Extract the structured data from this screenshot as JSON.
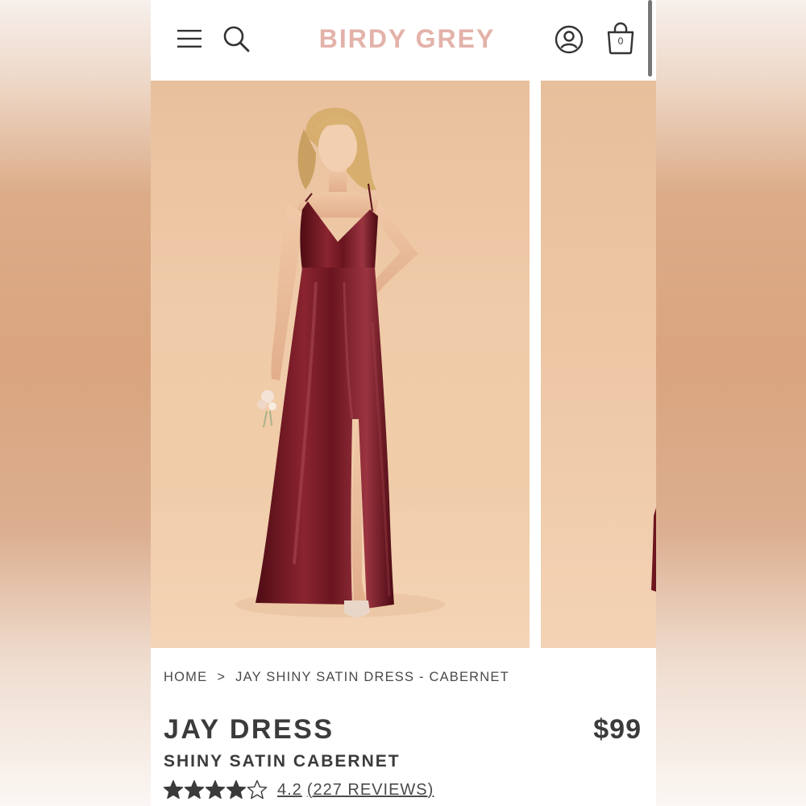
{
  "header": {
    "logo": "BIRDY GREY",
    "cart_count": "0"
  },
  "icons": {
    "menu": "hamburger-menu-icon",
    "search": "search-icon",
    "account": "account-icon",
    "cart": "shopping-bag-icon"
  },
  "breadcrumb": {
    "home": "HOME",
    "separator": ">",
    "current": "JAY SHINY SATIN DRESS - CABERNET"
  },
  "product": {
    "title": "JAY DRESS",
    "subtitle": "SHINY SATIN CABERNET",
    "price": "$99",
    "rating_value": "4.2",
    "rating_max": 5,
    "reviews_label": "(227 REVIEWS)"
  },
  "colors": {
    "logo": "#e3b2a9",
    "dress": "#6e1620",
    "text": "#3b3b3b",
    "backdrop": "#f0cba9"
  }
}
